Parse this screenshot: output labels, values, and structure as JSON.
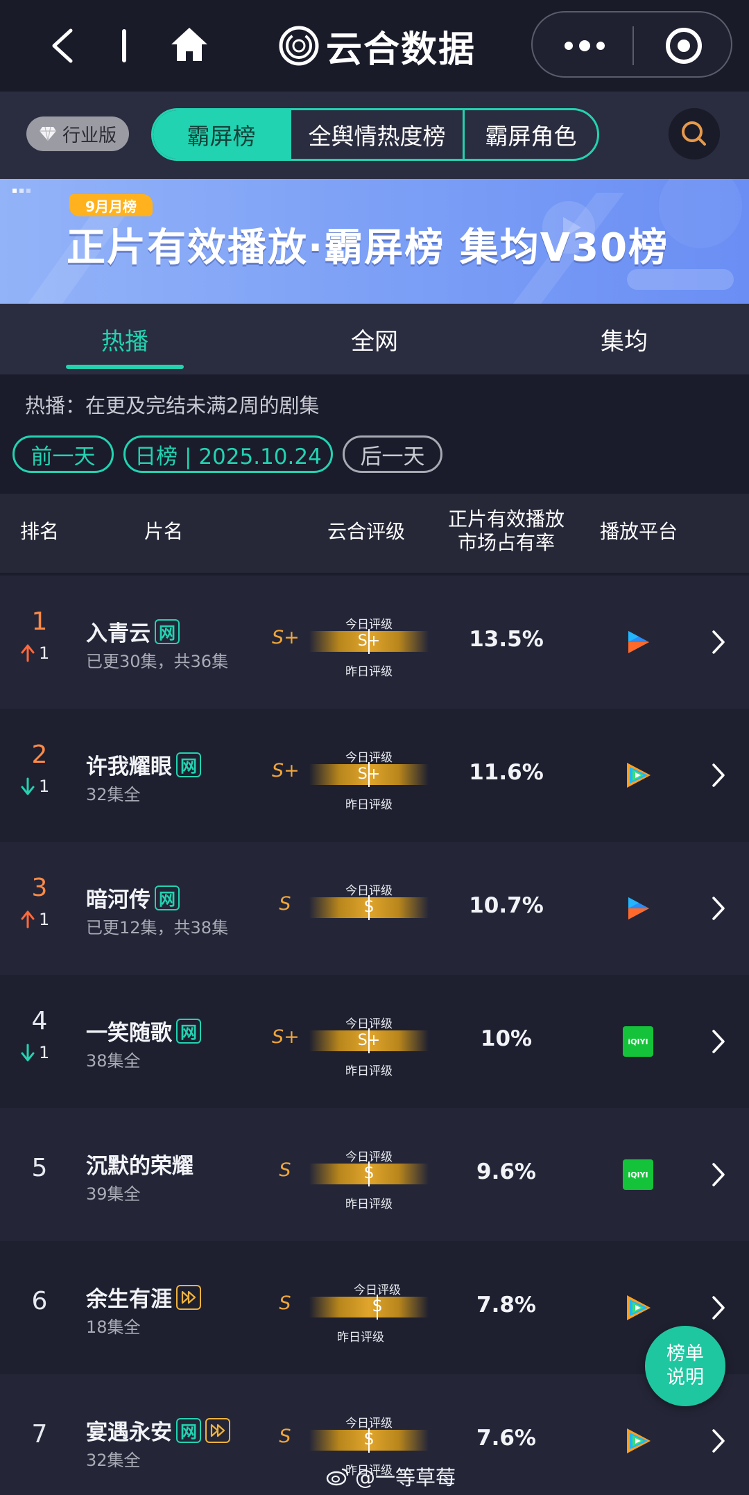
{
  "nav": {
    "brand_name": "云合数据"
  },
  "filter": {
    "edition_label": "行业版",
    "segments": [
      "霸屏榜",
      "全舆情热度榜",
      "霸屏角色"
    ],
    "active_segment": 0
  },
  "banner": {
    "tag": "9月月榜",
    "title": "正片有效播放·霸屏榜 集均V30榜"
  },
  "tabs": [
    "热播",
    "全网",
    "集均"
  ],
  "description": "热播：在更及完结未满2周的剧集",
  "dates": {
    "prev": "前一天",
    "current": "日榜 | 2025.10.24",
    "next": "后一天"
  },
  "table": {
    "headers": {
      "rank": "排名",
      "title": "片名",
      "grade": "云合评级",
      "share_line1": "正片有效播放",
      "share_line2": "市场占有率",
      "platform": "播放平台"
    },
    "meter_today_label": "今日评级",
    "meter_yesterday_label": "昨日评级",
    "rows": [
      {
        "rank": "1",
        "trend": "up",
        "trend_value": "1",
        "title": "入青云",
        "badges": [
          "net"
        ],
        "subtitle": "已更30集，共36集",
        "grade": "S+",
        "meter_value": "S+",
        "share": "13.5%",
        "platform": "youku"
      },
      {
        "rank": "2",
        "trend": "down",
        "trend_value": "1",
        "title": "许我耀眼",
        "badges": [
          "net"
        ],
        "subtitle": "32集全",
        "grade": "S+",
        "meter_value": "S+",
        "share": "11.6%",
        "platform": "tencent"
      },
      {
        "rank": "3",
        "trend": "up",
        "trend_value": "1",
        "title": "暗河传",
        "badges": [
          "net"
        ],
        "subtitle": "已更12集，共38集",
        "grade": "S",
        "meter_value": "S",
        "share": "10.7%",
        "platform": "youku"
      },
      {
        "rank": "4",
        "trend": "down",
        "trend_value": "1",
        "title": "一笑随歌",
        "badges": [
          "net"
        ],
        "subtitle": "38集全",
        "grade": "S+",
        "meter_value": "S+",
        "share": "10%",
        "platform": "iqiyi"
      },
      {
        "rank": "5",
        "trend": "none",
        "trend_value": "",
        "title": "沉默的荣耀",
        "badges": [],
        "subtitle": "39集全",
        "grade": "S",
        "meter_value": "S",
        "share": "9.6%",
        "platform": "iqiyi"
      },
      {
        "rank": "6",
        "trend": "none",
        "trend_value": "",
        "title": "余生有涯",
        "badges": [
          "vip"
        ],
        "subtitle": "18集全",
        "grade": "S",
        "meter_value": "S",
        "share": "7.8%",
        "platform": "tencent"
      },
      {
        "rank": "7",
        "trend": "none",
        "trend_value": "",
        "title": "宴遇永安",
        "badges": [
          "net",
          "vip"
        ],
        "subtitle": "32集全",
        "grade": "S",
        "meter_value": "S",
        "share": "7.6%",
        "platform": "tencent"
      }
    ]
  },
  "net_badge_text": "网",
  "iqiyi_text": "iQIYI",
  "fab": {
    "line1": "榜单",
    "line2": "说明"
  },
  "watermark": "@一等草莓",
  "colors": {
    "accent": "#22d3b1",
    "rank_top": "#ff8a46",
    "trend_up": "#ff6a3d",
    "trend_down": "#22d3b1",
    "grade": "#f0a63a"
  }
}
